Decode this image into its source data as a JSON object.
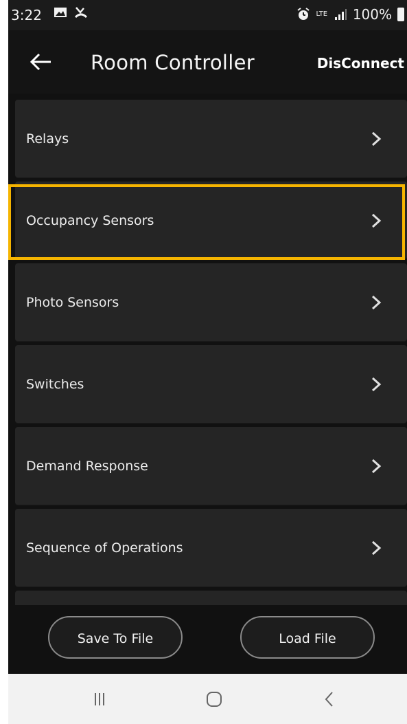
{
  "status_bar": {
    "time": "3:22",
    "network": "LTE",
    "battery": "100%",
    "icons": [
      "image-icon",
      "missed-call-icon",
      "alarm-icon",
      "lte-icon",
      "signal-icon",
      "battery-icon"
    ]
  },
  "app_bar": {
    "title": "Room Controller",
    "disconnect_label": "DisConnect",
    "back_icon": "back-arrow-icon"
  },
  "menu": {
    "items": [
      {
        "label": "Relays"
      },
      {
        "label": "Occupancy Sensors"
      },
      {
        "label": "Photo Sensors"
      },
      {
        "label": "Switches"
      },
      {
        "label": "Demand Response"
      },
      {
        "label": "Sequence of Operations"
      }
    ],
    "highlight_color": "#f5b400"
  },
  "actions": {
    "save_label": "Save To File",
    "load_label": "Load File"
  },
  "nav_bar": {
    "icons": [
      "recent-apps-icon",
      "home-icon",
      "back-icon"
    ]
  },
  "colors": {
    "background": "#111111",
    "card": "#252525",
    "text": "#ececec",
    "accent": "#f5b400"
  }
}
